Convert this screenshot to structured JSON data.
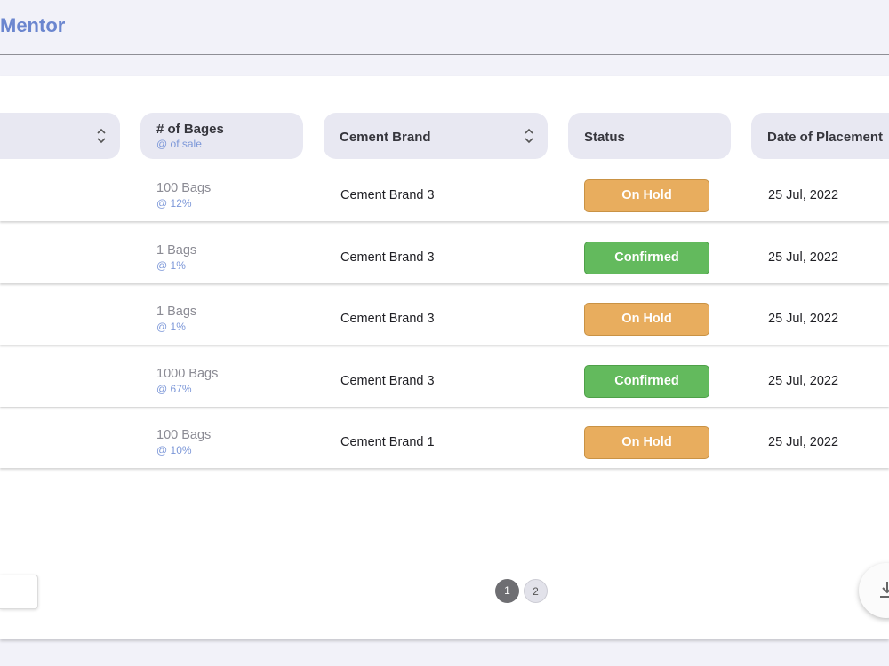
{
  "app": {
    "title": "Mentor"
  },
  "table": {
    "headers": {
      "bags": {
        "label": "# of Bages",
        "sub": "@ of sale"
      },
      "brand": "Cement Brand",
      "status": "Status",
      "date": "Date of Placement"
    },
    "rows": [
      {
        "bags": "100 Bags",
        "pct": "@ 12%",
        "brand": "Cement Brand 3",
        "status": "On Hold",
        "date": "25 Jul, 2022"
      },
      {
        "bags": "1 Bags",
        "pct": "@ 1%",
        "brand": "Cement Brand 3",
        "status": "Confirmed",
        "date": "25 Jul, 2022"
      },
      {
        "bags": "1 Bags",
        "pct": "@ 1%",
        "brand": "Cement Brand 3",
        "status": "On Hold",
        "date": "25 Jul, 2022"
      },
      {
        "bags": "1000 Bags",
        "pct": "@ 67%",
        "brand": "Cement Brand 3",
        "status": "Confirmed",
        "date": "25 Jul, 2022"
      },
      {
        "bags": "100 Bags",
        "pct": "@ 10%",
        "brand": "Cement Brand 1",
        "status": "On Hold",
        "date": "25 Jul, 2022"
      }
    ]
  },
  "pagination": {
    "pages": [
      "1",
      "2"
    ],
    "current": "1"
  },
  "icons": {
    "sort": "sort-icon",
    "download": "download-icon"
  },
  "colors": {
    "on_hold": "#e8ad5e",
    "confirmed": "#63ba5d",
    "brand": "#6b86cf"
  }
}
